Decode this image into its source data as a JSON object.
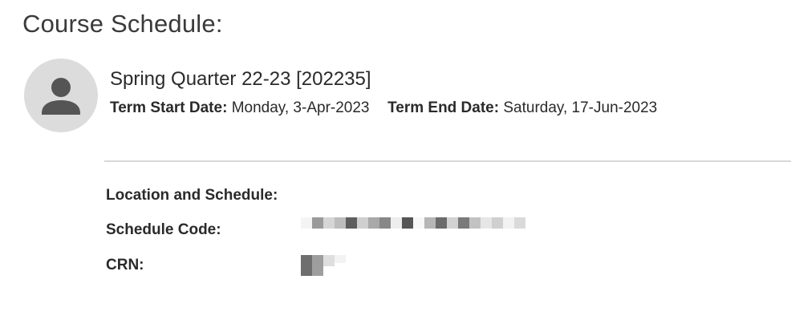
{
  "page": {
    "title": "Course Schedule:"
  },
  "term": {
    "avatar_icon": "person-icon",
    "name": "Spring Quarter 22-23 [202235]",
    "start_label": "Term Start Date:",
    "start_value": "Monday, 3-Apr-2023",
    "end_label": "Term End Date:",
    "end_value": "Saturday, 17-Jun-2023"
  },
  "details": {
    "location_label": "Location and Schedule:",
    "schedule_code_label": "Schedule Code:",
    "crn_label": "CRN:"
  },
  "colors": {
    "avatar_bg": "#dcdcdc",
    "avatar_icon": "#555555",
    "divider": "#d8d8d8"
  }
}
